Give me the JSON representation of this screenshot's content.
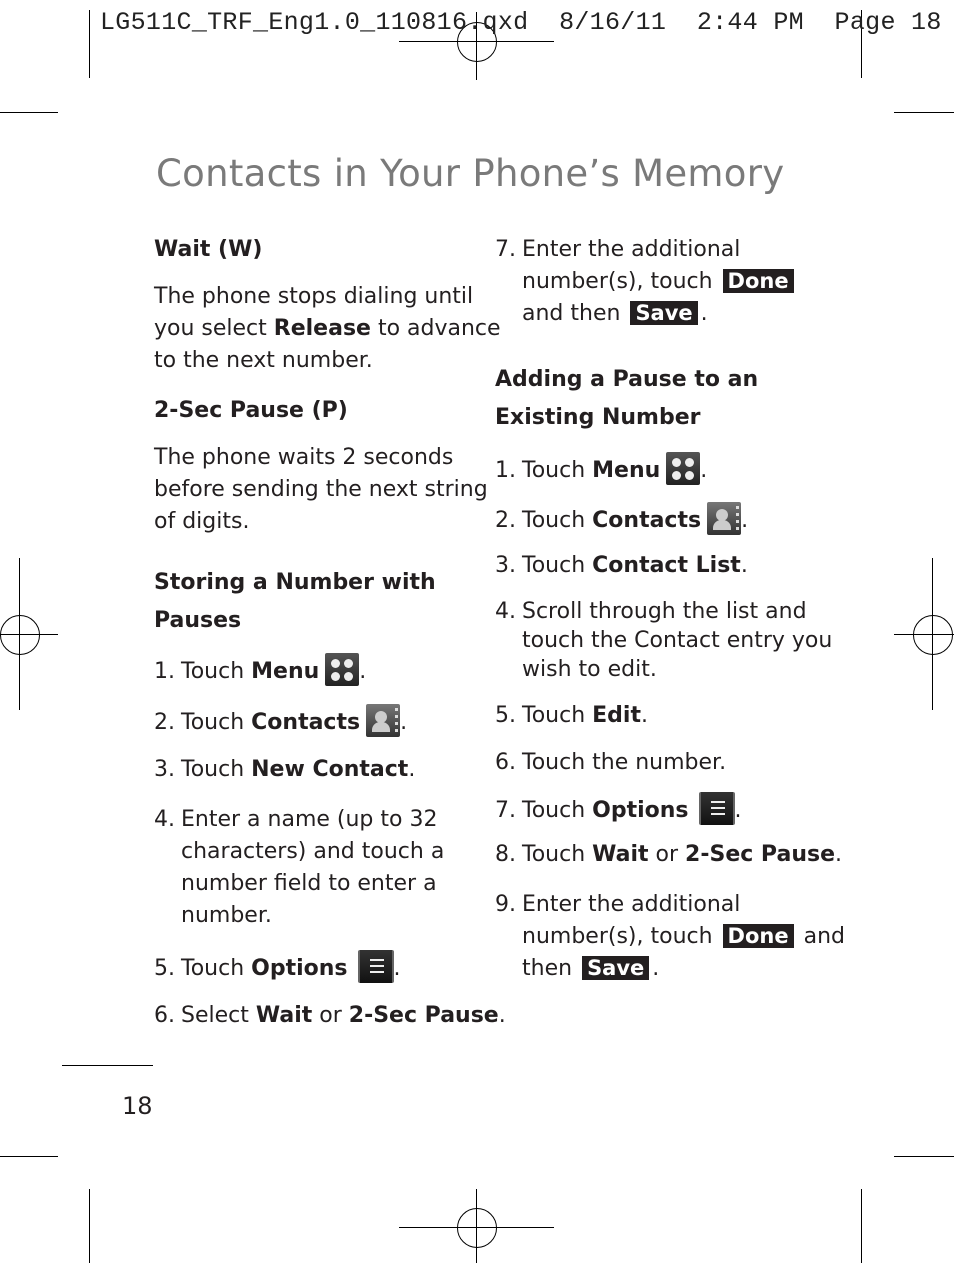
{
  "slug": {
    "filename": "LG511C_TRF_Eng1.0_110816.qxd",
    "date": "8/16/11",
    "time": "2:44 PM",
    "page_label": "Page 18"
  },
  "title": "Contacts in Your Phone’s Memory",
  "left_column": {
    "wait_heading": "Wait (W)",
    "wait_body": [
      "The phone stops dialing until",
      "you select ",
      "Release",
      " to advance",
      "to the next number."
    ],
    "pause_heading": "2-Sec Pause (P)",
    "pause_body": [
      "The phone waits 2 seconds",
      "before sending the next string",
      "of digits."
    ],
    "storing_heading": [
      "Storing a Number with",
      "Pauses"
    ],
    "steps": [
      {
        "num": "1.",
        "text": "Touch ",
        "bold": "Menu",
        "icon": "menu-grid-icon",
        "after": "."
      },
      {
        "num": "2.",
        "text": "Touch ",
        "bold": "Contacts",
        "icon": "contacts-icon",
        "after": "."
      },
      {
        "num": "3.",
        "text": "Touch ",
        "bold": "New Contact",
        "after": "."
      },
      {
        "num": "4.",
        "lines": [
          "Enter a name (up to 32",
          "characters) and touch a",
          "number field to enter a",
          "number."
        ]
      },
      {
        "num": "5.",
        "text": "Touch ",
        "bold": "Options",
        "icon": "options-list-icon",
        "after": "."
      },
      {
        "num": "6.",
        "text": "Select ",
        "bold": "Wait",
        "mid": " or ",
        "bold2": "2-Sec Pause",
        "after": "."
      }
    ]
  },
  "right_column": {
    "step7": {
      "num": "7.",
      "line1": "Enter the additional",
      "line2": "number(s), touch",
      "done": "Done",
      "line3": "and then",
      "save": "Save",
      "after": "."
    },
    "adding_heading": [
      "Adding a Pause to an",
      "Existing Number"
    ],
    "steps": [
      {
        "num": "1.",
        "text": "Touch ",
        "bold": "Menu",
        "icon": "menu-grid-icon",
        "after": "."
      },
      {
        "num": "2.",
        "text": "Touch ",
        "bold": "Contacts",
        "icon": "contacts-icon",
        "after": "."
      },
      {
        "num": "3.",
        "text": "Touch ",
        "bold": "Contact List",
        "after": "."
      },
      {
        "num": "4.",
        "lines": [
          "Scroll through the list and",
          "touch the Contact entry you",
          "wish to edit."
        ]
      },
      {
        "num": "5.",
        "text": "Touch ",
        "bold": "Edit",
        "after": "."
      },
      {
        "num": "6.",
        "text": "Touch the number."
      },
      {
        "num": "7.",
        "text": "Touch ",
        "bold": "Options",
        "icon": "options-list-icon",
        "after": "."
      },
      {
        "num": "8.",
        "text": "Touch ",
        "bold": "Wait",
        "mid": " or ",
        "bold2": "2-Sec Pause",
        "after": "."
      },
      {
        "num": "9.",
        "line1": "Enter the additional",
        "line2": "number(s), touch",
        "done": "Done",
        "and": "and",
        "line3": "then",
        "save": "Save",
        "after": "."
      }
    ]
  },
  "page_number": "18"
}
